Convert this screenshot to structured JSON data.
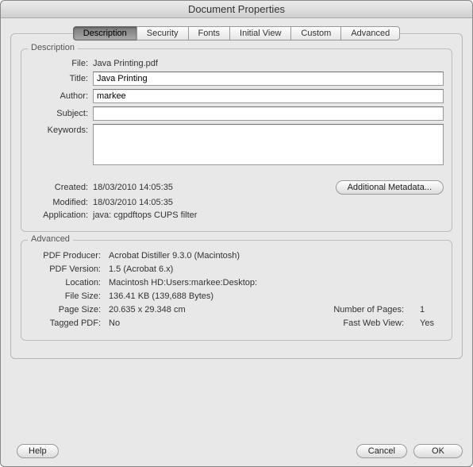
{
  "window": {
    "title": "Document Properties"
  },
  "tabs": {
    "description": "Description",
    "security": "Security",
    "fonts": "Fonts",
    "initial_view": "Initial View",
    "custom": "Custom",
    "advanced": "Advanced"
  },
  "description_group": {
    "label": "Description",
    "file_label": "File:",
    "file_value": "Java Printing.pdf",
    "title_label": "Title:",
    "title_value": "Java Printing",
    "author_label": "Author:",
    "author_value": "markee",
    "subject_label": "Subject:",
    "subject_value": "",
    "keywords_label": "Keywords:",
    "keywords_value": "",
    "created_label": "Created:",
    "created_value": "18/03/2010 14:05:35",
    "modified_label": "Modified:",
    "modified_value": "18/03/2010 14:05:35",
    "application_label": "Application:",
    "application_value": "java: cgpdftops CUPS filter",
    "additional_metadata_btn": "Additional Metadata..."
  },
  "advanced_group": {
    "label": "Advanced",
    "pdf_producer_label": "PDF Producer:",
    "pdf_producer_value": "Acrobat Distiller 9.3.0 (Macintosh)",
    "pdf_version_label": "PDF Version:",
    "pdf_version_value": "1.5 (Acrobat 6.x)",
    "location_label": "Location:",
    "location_value": "Macintosh HD:Users:markee:Desktop:",
    "file_size_label": "File Size:",
    "file_size_value": "136.41 KB (139,688 Bytes)",
    "page_size_label": "Page Size:",
    "page_size_value": "20.635 x 29.348 cm",
    "number_of_pages_label": "Number of Pages:",
    "number_of_pages_value": "1",
    "tagged_pdf_label": "Tagged PDF:",
    "tagged_pdf_value": "No",
    "fast_web_view_label": "Fast Web View:",
    "fast_web_view_value": "Yes"
  },
  "buttons": {
    "help": "Help",
    "cancel": "Cancel",
    "ok": "OK"
  }
}
